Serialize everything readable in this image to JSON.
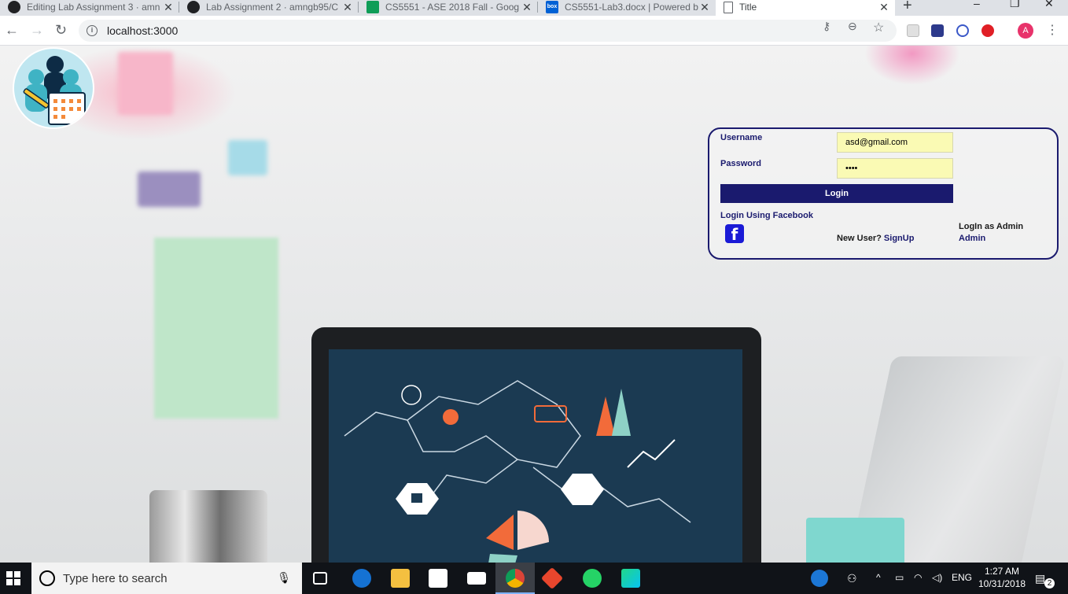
{
  "browser": {
    "tabs": [
      {
        "title": "Editing Lab Assignment 3 · amn",
        "favicon": "github-icon",
        "active": false
      },
      {
        "title": "Lab Assignment 2 · amngb95/C",
        "favicon": "github-icon",
        "active": false
      },
      {
        "title": "CS5551 - ASE 2018 Fall - Goog",
        "favicon": "sheets-icon",
        "active": false
      },
      {
        "title": "CS5551-Lab3.docx | Powered b",
        "favicon": "box-icon",
        "active": false
      },
      {
        "title": "Title",
        "favicon": "document-icon",
        "active": true
      }
    ],
    "url": "localhost:3000",
    "profile_initial": "A",
    "box_favicon_text": "box"
  },
  "login": {
    "username_label": "Username",
    "username_value": "asd@gmail.com",
    "password_label": "Password",
    "password_value": "••••",
    "login_button": "Login",
    "facebook_link": "Login Using Facebook",
    "facebook_glyph": "f",
    "new_user_text": "New User?",
    "signup_link": "SignUp",
    "admin_label": "LogIn as Admin",
    "admin_link": "Admin"
  },
  "taskbar": {
    "search_placeholder": "Type here to search",
    "language": "ENG",
    "time": "1:27 AM",
    "date": "10/31/2018",
    "notification_count": "2"
  }
}
